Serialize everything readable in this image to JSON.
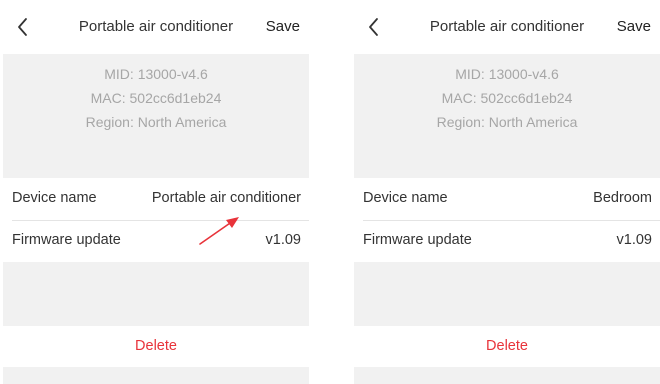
{
  "screens": [
    {
      "header": {
        "title": "Portable air conditioner",
        "save_label": "Save",
        "back_icon": "chevron-left-icon"
      },
      "info": {
        "mid": "MID: 13000-v4.6",
        "mac": "MAC: 502cc6d1eb24",
        "region": "Region: North America"
      },
      "settings": {
        "device_name_label": "Device name",
        "device_name_value": "Portable air conditioner",
        "firmware_label": "Firmware update",
        "firmware_value": "v1.09"
      },
      "delete_label": "Delete"
    },
    {
      "header": {
        "title": "Portable air conditioner",
        "save_label": "Save",
        "back_icon": "chevron-left-icon"
      },
      "info": {
        "mid": "MID: 13000-v4.6",
        "mac": "MAC: 502cc6d1eb24",
        "region": "Region: North America"
      },
      "settings": {
        "device_name_label": "Device name",
        "device_name_value": "Bedroom",
        "firmware_label": "Firmware update",
        "firmware_value": "v1.09"
      },
      "delete_label": "Delete"
    }
  ],
  "annotation": {
    "arrow_icon": "red-arrow-icon",
    "arrow_color": "#e8333a"
  },
  "colors": {
    "delete": "#e8333a",
    "background": "#f1f1f1",
    "info_text": "#a6a6a6"
  }
}
